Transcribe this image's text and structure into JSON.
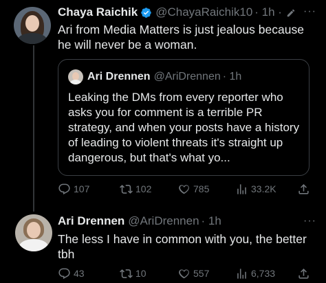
{
  "tweet1": {
    "author_name": "Chaya Raichik",
    "handle": "@ChayaRaichik10",
    "time": "· 1h ·",
    "text": "Ari from Media Matters is just jealous because he will never be a woman.",
    "more": "···",
    "quote": {
      "author_name": "Ari Drennen",
      "handle": "@AriDrennen",
      "time": "· 1h",
      "text": "Leaking the DMs from every reporter who asks you for comment is a terrible PR strategy, and when your posts have a history of leading to violent threats it's straight up dangerous, but that's what yo..."
    },
    "actions": {
      "replies": "107",
      "retweets": "102",
      "likes": "785",
      "views": "33.2K"
    }
  },
  "tweet2": {
    "author_name": "Ari Drennen",
    "handle": "@AriDrennen",
    "time": "· 1h",
    "text": "The less I have in common with you, the better tbh",
    "more": "···",
    "actions": {
      "replies": "43",
      "retweets": "10",
      "likes": "557",
      "views": "6,733"
    }
  },
  "colors": {
    "background": "#000000",
    "text": "#e7e9ea",
    "secondary": "#71767b",
    "verified": "#1d9bf0",
    "border": "#3b3f44"
  },
  "icons": [
    "verified-badge-icon",
    "pencil-icon",
    "reply-icon",
    "retweet-icon",
    "like-icon",
    "views-icon",
    "share-icon"
  ]
}
